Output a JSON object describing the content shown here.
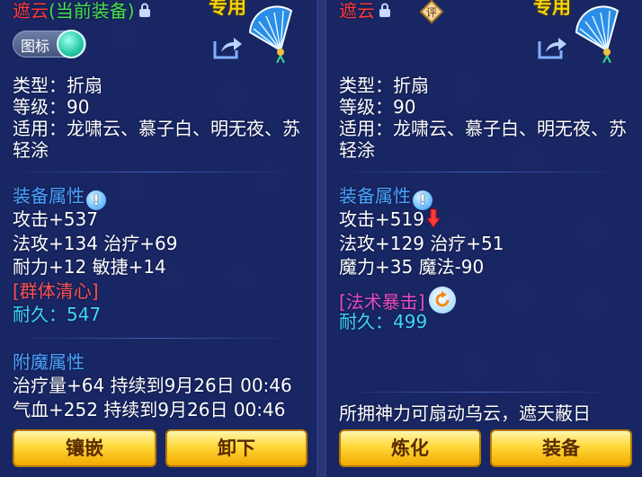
{
  "left": {
    "name_main": "遮云",
    "name_suffix": "(当前装备)",
    "exclusive": "专用",
    "toggle_label": "图标",
    "type": "类型：折扇",
    "level": "等级：90",
    "applicable_1": "适用：龙啸云、慕子白、明无夜、苏",
    "applicable_2": "轻涂",
    "attr_title": "装备属性",
    "attack": "攻击+537",
    "magic_heal": "法攻+134 治疗+69",
    "stamina_agility": "耐力+12 敏捷+14",
    "skill": "[群体清心]",
    "durability": "耐久：547",
    "enchant_title": "附魔属性",
    "enchant_1": "治疗量+64 持续到9月26日 00:46",
    "enchant_2": "气血+252 持续到9月26日 00:46",
    "btn_inlay": "镶嵌",
    "btn_unequip": "卸下"
  },
  "right": {
    "name_main": "遮云",
    "badge": "评",
    "exclusive": "专用",
    "type": "类型：折扇",
    "level": "等级：90",
    "applicable_1": "适用：龙啸云、慕子白、明无夜、苏",
    "applicable_2": "轻涂",
    "attr_title": "装备属性",
    "attack": "攻击+519",
    "magic_heal": "法攻+129 治疗+51",
    "magic_mana": "魔力+35 魔法-90",
    "skill": "[法术暴击]",
    "durability": "耐久：499",
    "description": "所拥神力可扇动乌云，遮天蔽日",
    "btn_refine": "炼化",
    "btn_equip": "装备"
  },
  "colors": {
    "name_red": "#ff3a3a",
    "current_green": "#45e04a",
    "exclusive_yellow": "#f5d400",
    "section_blue": "#4aa3ff",
    "durability_cyan": "#3fd6ff",
    "skill_red": "#ff5252",
    "skill_pink": "#e84cc2",
    "button_gold": "#ffd83a"
  },
  "icons": {
    "lock": "lock-icon",
    "fan": "folding-fan-icon",
    "share": "share-icon",
    "info": "info-icon",
    "down": "arrow-down-icon",
    "refresh": "refresh-icon",
    "badge": "rating-badge-icon"
  }
}
